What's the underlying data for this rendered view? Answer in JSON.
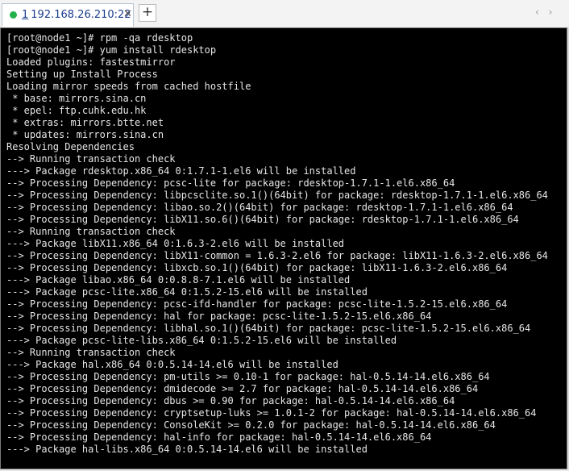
{
  "tab": {
    "index": "1",
    "title": "192.168.26.210:22",
    "close_glyph": "✕",
    "status_color": "#23b14d"
  },
  "newtab_glyph": "+",
  "nav_arrows": "‹ ›",
  "terminal": {
    "lines": [
      "[root@node1 ~]# rpm -qa rdesktop",
      "[root@node1 ~]# yum install rdesktop",
      "Loaded plugins: fastestmirror",
      "Setting up Install Process",
      "Loading mirror speeds from cached hostfile",
      " * base: mirrors.sina.cn",
      " * epel: ftp.cuhk.edu.hk",
      " * extras: mirrors.btte.net",
      " * updates: mirrors.sina.cn",
      "Resolving Dependencies",
      "--> Running transaction check",
      "---> Package rdesktop.x86_64 0:1.7.1-1.el6 will be installed",
      "--> Processing Dependency: pcsc-lite for package: rdesktop-1.7.1-1.el6.x86_64",
      "--> Processing Dependency: libpcsclite.so.1()(64bit) for package: rdesktop-1.7.1-1.el6.x86_64",
      "--> Processing Dependency: libao.so.2()(64bit) for package: rdesktop-1.7.1-1.el6.x86_64",
      "--> Processing Dependency: libX11.so.6()(64bit) for package: rdesktop-1.7.1-1.el6.x86_64",
      "--> Running transaction check",
      "---> Package libX11.x86_64 0:1.6.3-2.el6 will be installed",
      "--> Processing Dependency: libX11-common = 1.6.3-2.el6 for package: libX11-1.6.3-2.el6.x86_64",
      "--> Processing Dependency: libxcb.so.1()(64bit) for package: libX11-1.6.3-2.el6.x86_64",
      "---> Package libao.x86_64 0:0.8.8-7.1.el6 will be installed",
      "---> Package pcsc-lite.x86_64 0:1.5.2-15.el6 will be installed",
      "--> Processing Dependency: pcsc-ifd-handler for package: pcsc-lite-1.5.2-15.el6.x86_64",
      "--> Processing Dependency: hal for package: pcsc-lite-1.5.2-15.el6.x86_64",
      "--> Processing Dependency: libhal.so.1()(64bit) for package: pcsc-lite-1.5.2-15.el6.x86_64",
      "---> Package pcsc-lite-libs.x86_64 0:1.5.2-15.el6 will be installed",
      "--> Running transaction check",
      "---> Package hal.x86_64 0:0.5.14-14.el6 will be installed",
      "--> Processing Dependency: pm-utils >= 0.10-1 for package: hal-0.5.14-14.el6.x86_64",
      "--> Processing Dependency: dmidecode >= 2.7 for package: hal-0.5.14-14.el6.x86_64",
      "--> Processing Dependency: dbus >= 0.90 for package: hal-0.5.14-14.el6.x86_64",
      "--> Processing Dependency: cryptsetup-luks >= 1.0.1-2 for package: hal-0.5.14-14.el6.x86_64",
      "--> Processing Dependency: ConsoleKit >= 0.2.0 for package: hal-0.5.14-14.el6.x86_64",
      "--> Processing Dependency: hal-info for package: hal-0.5.14-14.el6.x86_64",
      "---> Package hal-libs.x86_64 0:0.5.14-14.el6 will be installed"
    ]
  }
}
